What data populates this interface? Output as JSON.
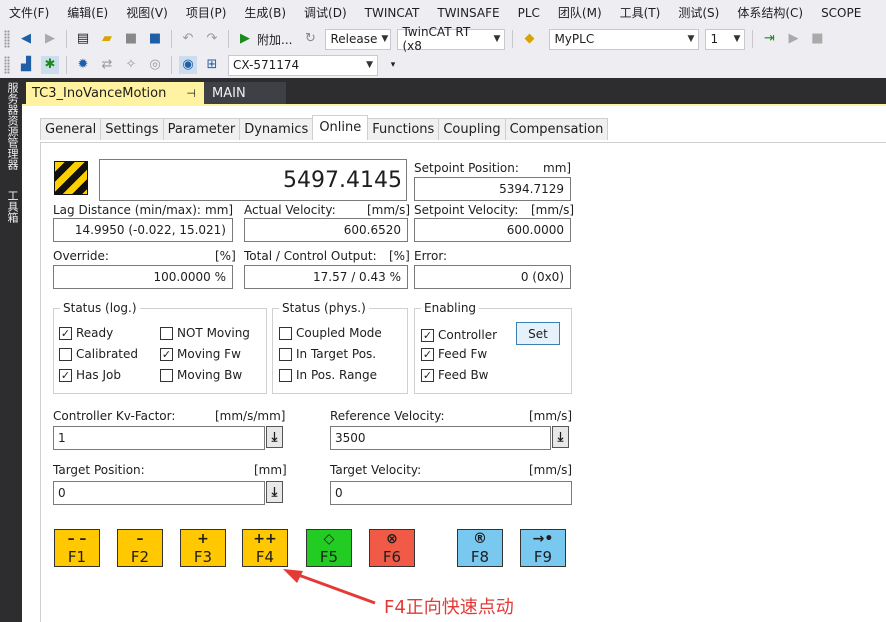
{
  "menu": [
    "文件(F)",
    "编辑(E)",
    "视图(V)",
    "项目(P)",
    "生成(B)",
    "调试(D)",
    "TWINCAT",
    "TWINSAFE",
    "PLC",
    "团队(M)",
    "工具(T)",
    "测试(S)",
    "体系结构(C)",
    "SCOPE"
  ],
  "toolbar": {
    "attach_label": "附加...",
    "config": "Release",
    "platform": "TwinCAT RT (x8",
    "plc": "MyPLC",
    "instance": "1",
    "target": "CX-571174"
  },
  "rail": {
    "server_explorer": "服务器资源管理器",
    "toolbox": "工具箱"
  },
  "doctabs": {
    "active": "TC3_InoVanceMotion",
    "other": "MAIN"
  },
  "subtabs": [
    "General",
    "Settings",
    "Parameter",
    "Dynamics",
    "Online",
    "Functions",
    "Coupling",
    "Compensation"
  ],
  "online": {
    "position_value": "5497.4145",
    "setpoint_position_label": "Setpoint Position:",
    "setpoint_position_unit": "mm]",
    "setpoint_position_value": "5394.7129",
    "lag_label": "Lag Distance (min/max):",
    "lag_unit": "mm]",
    "lag_value": "14.9950  (-0.022, 15.021)",
    "actual_velocity_label": "Actual Velocity:",
    "actual_velocity_unit": "[mm/s]",
    "actual_velocity_value": "600.6520",
    "setpoint_velocity_label": "Setpoint Velocity:",
    "setpoint_velocity_unit": "[mm/s]",
    "setpoint_velocity_value": "600.0000",
    "override_label": "Override:",
    "override_unit": "[%]",
    "override_value": "100.0000 %",
    "total_output_label": "Total / Control Output:",
    "total_output_unit": "[%]",
    "total_output_value": "17.57 /  0.43 %",
    "error_label": "Error:",
    "error_value": "0 (0x0)"
  },
  "status_log": {
    "title": "Status (log.)",
    "items": [
      {
        "label": "Ready",
        "checked": true
      },
      {
        "label": "Calibrated",
        "checked": false
      },
      {
        "label": "Has Job",
        "checked": true
      },
      {
        "label": "NOT Moving",
        "checked": false
      },
      {
        "label": "Moving Fw",
        "checked": true
      },
      {
        "label": "Moving Bw",
        "checked": false
      }
    ]
  },
  "status_phys": {
    "title": "Status (phys.)",
    "items": [
      {
        "label": "Coupled Mode",
        "checked": false
      },
      {
        "label": "In Target Pos.",
        "checked": false
      },
      {
        "label": "In Pos. Range",
        "checked": false
      }
    ]
  },
  "enabling": {
    "title": "Enabling",
    "items": [
      {
        "label": "Controller",
        "checked": true
      },
      {
        "label": "Feed Fw",
        "checked": true
      },
      {
        "label": "Feed Bw",
        "checked": true
      }
    ],
    "set_label": "Set"
  },
  "params": {
    "kv_label": "Controller Kv-Factor:",
    "kv_unit": "[mm/s/mm]",
    "kv_value": "1",
    "ref_vel_label": "Reference Velocity:",
    "ref_vel_unit": "[mm/s]",
    "ref_vel_value": "3500",
    "target_pos_label": "Target Position:",
    "target_pos_unit": "[mm]",
    "target_pos_value": "0",
    "target_vel_label": "Target Velocity:",
    "target_vel_unit": "[mm/s]",
    "target_vel_value": "0"
  },
  "fkeys": [
    {
      "symbol": "– –",
      "label": "F1",
      "color": "#ffc800"
    },
    {
      "symbol": "–",
      "label": "F2",
      "color": "#ffc800"
    },
    {
      "symbol": "+",
      "label": "F3",
      "color": "#ffc800"
    },
    {
      "symbol": "++",
      "label": "F4",
      "color": "#ffc800"
    },
    {
      "symbol": "◇",
      "label": "F5",
      "color": "#22cc22"
    },
    {
      "symbol": "⊗",
      "label": "F6",
      "color": "#f05a46"
    },
    {
      "symbol": "®",
      "label": "F8",
      "color": "#78c8f0"
    },
    {
      "symbol": "→•",
      "label": "F9",
      "color": "#78c8f0"
    }
  ],
  "annotation": "F4正向快速点动",
  "colors": {
    "menu_bg": "#eeeef2",
    "dark_chrome": "#2d2d30",
    "active_tab": "#fff2a0",
    "annotation": "#e53935"
  }
}
